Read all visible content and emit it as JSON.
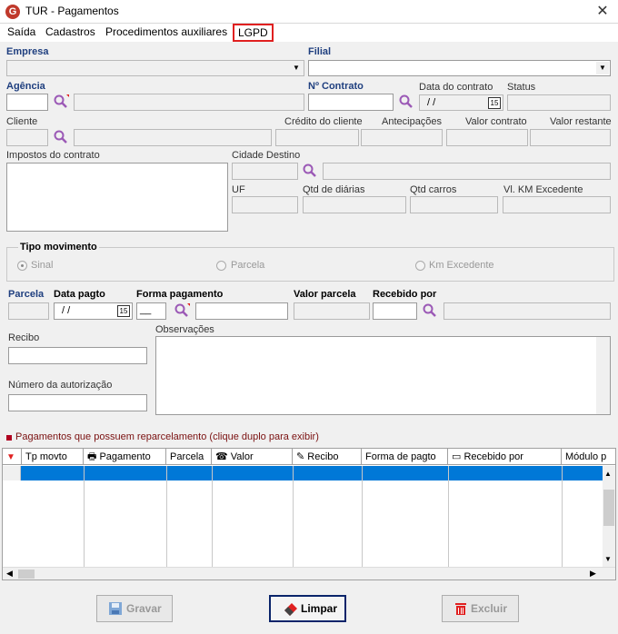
{
  "window": {
    "title": "TUR - Pagamentos",
    "app_icon": "G",
    "close_glyph": "✕"
  },
  "menu": {
    "items": [
      "Saída",
      "Cadastros",
      "Procedimentos auxiliares",
      "LGPD"
    ]
  },
  "labels": {
    "empresa": "Empresa",
    "filial": "Filial",
    "agencia": "Agência",
    "num_contrato": "Nº Contrato",
    "data_contrato": "Data do contrato",
    "status": "Status",
    "cliente": "Cliente",
    "credito": "Crédito do cliente",
    "antecipacoes": "Antecipações",
    "valor_contrato": "Valor contrato",
    "valor_restante": "Valor restante",
    "impostos": "Impostos do contrato",
    "cidade_destino": "Cidade Destino",
    "uf": "UF",
    "qtd_diarias": "Qtd de diárias",
    "qtd_carros": "Qtd carros",
    "vl_km": "Vl. KM Excedente",
    "tipo_movimento": "Tipo movimento",
    "parcela": "Parcela",
    "data_pagto": "Data pagto",
    "forma_pagamento": "Forma pagamento",
    "valor_parcela": "Valor parcela",
    "recebido_por": "Recebido por",
    "recibo": "Recibo",
    "observacoes": "Observações",
    "num_autorizacao": "Número da autorização",
    "reparcelamento": "Pagamentos que possuem reparcelamento (clique duplo para exibir)"
  },
  "fields": {
    "data_contrato_value": " /  /",
    "data_pagto_value": " /  /",
    "forma_pagamento_code": "__",
    "calendar_glyph": "15"
  },
  "radios": [
    {
      "label": "Sinal",
      "checked": true
    },
    {
      "label": "Parcela",
      "checked": false
    },
    {
      "label": "Km Excedente",
      "checked": false
    }
  ],
  "grid": {
    "columns": [
      "Tp movto",
      "Pagamento",
      "Parcela",
      "Valor",
      "Recibo",
      "Forma de pagto",
      "Recebido por",
      "Módulo p"
    ]
  },
  "buttons": {
    "gravar": "Gravar",
    "limpar": "Limpar",
    "excluir": "Excluir"
  },
  "colors": {
    "accent_red": "#c0392b",
    "selection_blue": "#0078d7",
    "label_blue": "#1f3f7f"
  }
}
